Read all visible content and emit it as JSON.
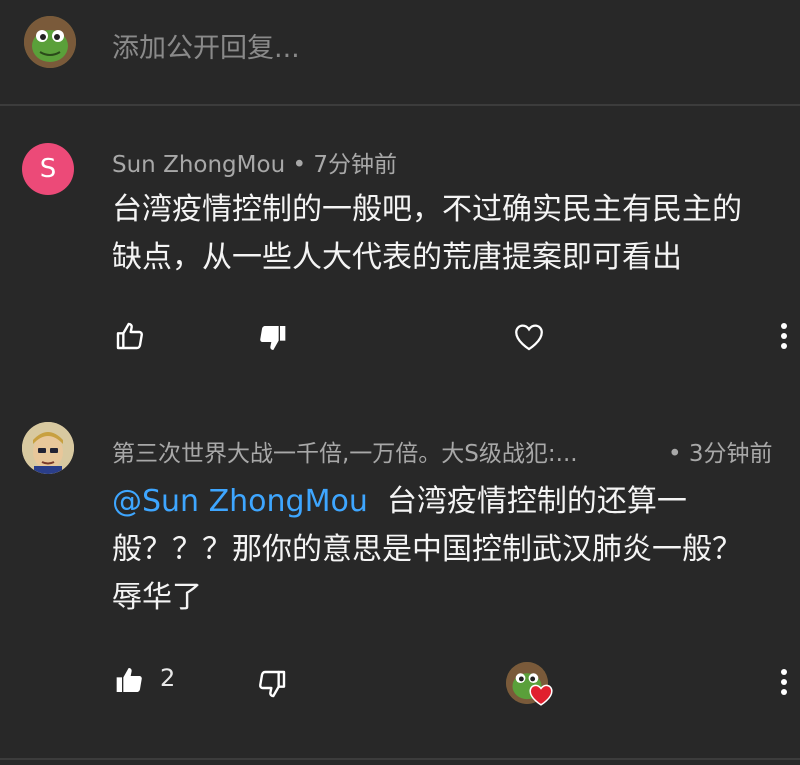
{
  "reply_bar": {
    "placeholder": "添加公开回复..."
  },
  "comments": [
    {
      "author": "Sun ZhongMou",
      "avatar_letter": "S",
      "avatar_color": "#ec4a78",
      "time": "7分钟前",
      "text_line1": "台湾疫情控制的一般吧，不过确实民主有民主的",
      "text_line2": "缺点，从一些人大代表的荒唐提案即可看出",
      "actions": {
        "like_icon": "thumbs-up-outline-icon",
        "dislike_icon": "thumbs-down-filled-icon",
        "heart_icon": "heart-outline-icon",
        "more_icon": "more-vert-icon"
      }
    },
    {
      "author": "第三次世界大战一千倍,一万倍。大S级战犯:...",
      "time": "3分钟前",
      "mention": "@Sun ZhongMou",
      "text_line1": "台湾疫情控制的还算一",
      "text_line2": "般？？？那你的意思是中国控制武汉肺炎一般？",
      "text_line3": "辱华了",
      "like_count": "2",
      "actions": {
        "like_icon": "thumbs-up-filled-icon",
        "dislike_icon": "thumbs-down-outline-icon",
        "heart_icon": "creator-heart-icon",
        "more_icon": "more-vert-icon"
      }
    }
  ],
  "colors": {
    "background": "#282828",
    "mention": "#3ea6ff",
    "heart_badge": "#e0202e"
  }
}
